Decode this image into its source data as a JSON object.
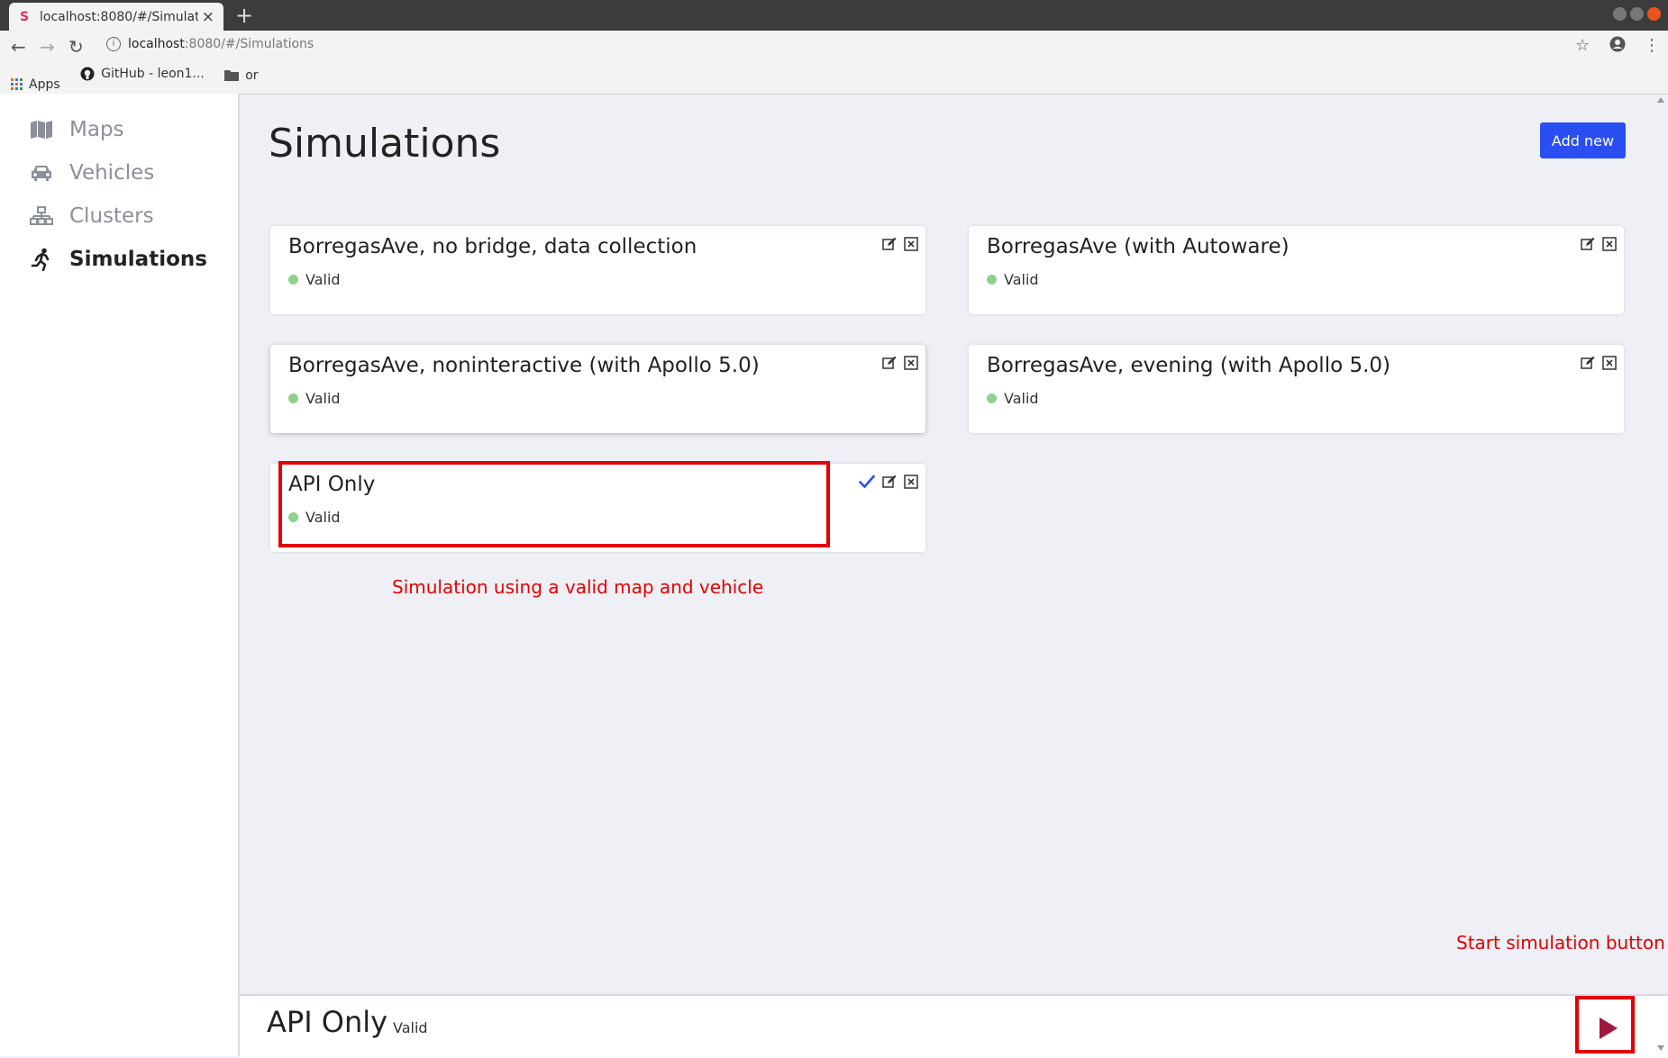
{
  "browser": {
    "tab_title": "localhost:8080/#/Simulations",
    "tab_close": "×",
    "new_tab": "+",
    "address_host": "localhost",
    "address_path": ":8080/#/Simulations",
    "bookmarks": [
      {
        "label": "Apps",
        "icon": "apps-grid-icon"
      },
      {
        "label": "GitHub - leon1...",
        "icon": "github-icon"
      },
      {
        "label": "or",
        "icon": "folder-icon"
      }
    ]
  },
  "sidebar": {
    "items": [
      {
        "label": "Maps",
        "icon": "map-icon",
        "active": false
      },
      {
        "label": "Vehicles",
        "icon": "car-icon",
        "active": false
      },
      {
        "label": "Clusters",
        "icon": "network-icon",
        "active": false
      },
      {
        "label": "Simulations",
        "icon": "running-person-icon",
        "active": true
      }
    ]
  },
  "main": {
    "title": "Simulations",
    "add_button": "Add new",
    "cards": [
      {
        "title": "BorregasAve, no bridge, data collection",
        "status": "Valid",
        "selected": false
      },
      {
        "title": "BorregasAve (with Autoware)",
        "status": "Valid",
        "selected": false
      },
      {
        "title": "BorregasAve, noninteractive (with Apollo 5.0)",
        "status": "Valid",
        "selected": false
      },
      {
        "title": "BorregasAve, evening (with Apollo 5.0)",
        "status": "Valid",
        "selected": false
      },
      {
        "title": "API Only",
        "status": "Valid",
        "selected": true
      }
    ],
    "annotations": {
      "card": "Simulation using a valid map and vehicle",
      "play": "Start simulation button"
    },
    "bottom": {
      "title": "API Only",
      "status": "Valid"
    }
  },
  "colors": {
    "accent": "#2b4ef2",
    "annotation": "#e30000",
    "valid": "#8fd18f",
    "play": "#a0183e"
  }
}
